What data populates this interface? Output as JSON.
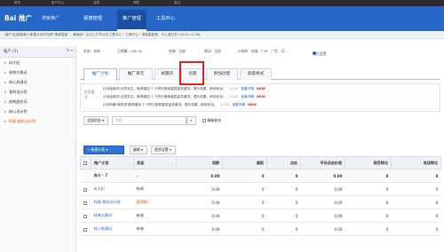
{
  "topbar": {
    "items": [
      "首页",
      "账户中心",
      "消息",
      "帮助",
      "退出"
    ]
  },
  "header": {
    "logo": "Bai 推广",
    "logo_sub": "搜索推广",
    "nav": [
      "便捷管理",
      "推广管理",
      "工具中心"
    ],
    "active_nav": "推广管理"
  },
  "notice": {
    "text": "[新产品]搜索新人新建计划时没带“搜索智能”，请使用？点击上方节点击工具中心 › 工具中心 › 搜索智能等，马上就打开 (2014-11-08)"
  },
  "sidebar": {
    "header": "账户 (7)",
    "items": [
      {
        "label": "纠大纪",
        "selected": false
      },
      {
        "label": "经典大概词",
        "selected": false
      },
      {
        "label": "核心关键词",
        "selected": false
      },
      {
        "label": "我的词计划",
        "selected": false
      },
      {
        "label": "经典类合词",
        "selected": false
      },
      {
        "label": "核心词计划",
        "selected": false
      },
      {
        "label": "阿鹿·商机词计划",
        "selected": true
      }
    ]
  },
  "status": {
    "state_label": "状态：有效",
    "budget": "日预算：180.00",
    "region": "地域：全部",
    "device": "移动：全部",
    "ip": "IP排除：地域 · 广州 · 广西 · 河...",
    "settings_link": "其它设置"
  },
  "tabs": [
    {
      "label": "推广计划",
      "active": true
    },
    {
      "label": "推广单元",
      "active": false
    },
    {
      "label": "关键词",
      "active": false
    },
    {
      "label": "创意",
      "active": false
    },
    {
      "label": "附加创意",
      "active": false
    },
    {
      "label": "高级样式",
      "active": false
    }
  ],
  "tips": {
    "label": "优化建议",
    "rows": [
      {
        "text": "计划经典词·必须关注，推荐增加 7 个同行推荐高质量关键词，提升效果，即刻优化。",
        "time": "11:00",
        "link": "查看详情",
        "badge": "NEW"
      },
      {
        "text": "计划经典词·必须关注，推荐增加 7 个同行推荐高质量关键词，提升效果，即刻优化。",
        "time": "11:00",
        "link": "查看详情",
        "badge": "NEW"
      },
      {
        "text": "计划阿鹿·商机词·推荐增加 7 个同行推荐高质量关键词，提升效果，即刻优化。",
        "time": "11:00",
        "link": "查看详情",
        "badge": "NEW"
      }
    ]
  },
  "filter": {
    "dropdown": "全部状态",
    "search_placeholder": "搜索",
    "exact_label": "精确查询"
  },
  "toolbar": {
    "add": "+ 新建计划",
    "edit": "编辑",
    "more": "更多设置"
  },
  "table": {
    "columns": [
      "推广计划",
      "状态",
      "消费",
      "展现",
      "点击",
      "平均点击价格",
      "网页转化",
      "电话转化"
    ],
    "total": {
      "label": "合计 - 7",
      "state": "-",
      "values": [
        "0.00",
        "0",
        "0",
        "0.00",
        "0",
        "0"
      ]
    },
    "rows": [
      {
        "name": "纠大纪",
        "state": "有效",
        "state_paused": false,
        "values": [
          "0.00",
          "0",
          "0",
          "0.00",
          "0",
          "0"
        ]
      },
      {
        "name": "阿鹿·商机词计划",
        "state": "暂停推广",
        "state_paused": true,
        "values": [
          "0.00",
          "0",
          "0",
          "0.00",
          "0",
          "0"
        ]
      },
      {
        "name": "经典大概词",
        "state": "有效",
        "state_paused": false,
        "values": [
          "0.00",
          "0",
          "0",
          "0.00",
          "0",
          "0"
        ]
      },
      {
        "name": "核心关键词",
        "state": "有效",
        "state_paused": false,
        "values": [
          "0.00",
          "0",
          "0",
          "0.00",
          "0",
          "0"
        ]
      }
    ]
  }
}
